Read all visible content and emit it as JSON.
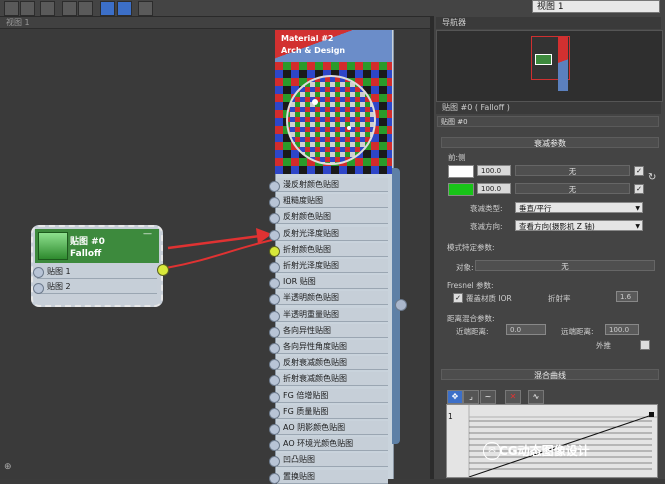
{
  "toolbar": {
    "view_dropdown": "视图 1"
  },
  "view_tab": "视图 1",
  "material_node": {
    "title_line1": "Material #2",
    "title_line2": "Arch & Design",
    "slots": [
      "漫反射颜色贴图",
      "粗糙度贴图",
      "反射颜色贴图",
      "反射光泽度贴图",
      "折射颜色贴图",
      "折射光泽度贴图",
      "IOR 贴图",
      "半透明颜色贴图",
      "半透明重量贴图",
      "各向异性贴图",
      "各向异性角度贴图",
      "反射衰减颜色贴图",
      "折射衰减颜色贴图",
      "FG 倍增贴图",
      "FG 质量贴图",
      "AO 阴影颜色贴图",
      "AO 环境光颜色贴图",
      "凹凸贴图",
      "置换贴图"
    ]
  },
  "falloff_node": {
    "title": "贴图 #0",
    "subtitle": "Falloff",
    "minimize": "—",
    "slots": [
      "贴图 1",
      "贴图 2"
    ]
  },
  "right_panel": {
    "navigator_title": "导航器",
    "map_title": "贴图 #0  ( Falloff )",
    "map_name": "贴图 #0",
    "falloff_params_title": "衰减参数",
    "front_side_label": "前:侧",
    "row1": {
      "value": "100.0",
      "button": "无"
    },
    "row2": {
      "value": "100.0",
      "button": "无"
    },
    "falloff_type_label": "衰减类型:",
    "falloff_type_value": "垂直/平行",
    "falloff_dir_label": "衰减方向:",
    "falloff_dir_value": "查看方向(摄影机 Z 轴)",
    "mode_params_label": "模式特定参数:",
    "object_label": "对象:",
    "object_button": "无",
    "fresnel_label": "Fresnel 参数:",
    "override_ior_label": "覆盖材质 IOR",
    "ior_label": "折射率",
    "ior_value": "1.6",
    "dist_blend_label": "距离混合参数:",
    "near_label": "近端距离:",
    "near_value": "0.0",
    "far_label": "远端距离:",
    "far_value": "100.0",
    "extrapolate_label": "外推",
    "mix_curve_title": "混合曲线",
    "curve_axis_label": "1"
  },
  "watermark": "CG动态图像设计",
  "colors": {
    "swatch1": "#ffffff",
    "swatch2": "#18c418",
    "arrow": "#e03232"
  }
}
